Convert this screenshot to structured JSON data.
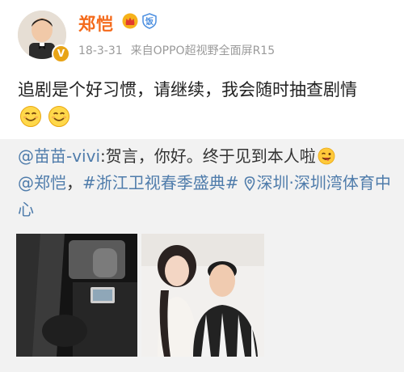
{
  "user": {
    "name": "郑恺",
    "time": "18-3-31",
    "source": "来自OPPO超视野全面屏R15",
    "avatar_icon": "avatar-photo",
    "badge_icon": "verified-v-icon",
    "crown_icon": "crown-icon",
    "fan_icon": "fan-club-icon",
    "name_color": "#f46a1b"
  },
  "post": {
    "text": "追剧是个好习惯，请继续，我会随时抽查剧情",
    "emoji_icon": "smile-emoji-icon"
  },
  "repost": {
    "author": "@苗苗-vivi",
    "text": ":贺言，你好。终于见到本人啦",
    "emoji_icon": "wink-emoji-icon",
    "mention": "@郑恺",
    "separator": "，",
    "topic": "#浙江卫视春季盛典#",
    "location_icon": "location-pin-icon",
    "location": "深圳·深圳湾体育中心",
    "link_color": "#4f7cab",
    "images": [
      {
        "name": "car-photo"
      },
      {
        "name": "selfie-photo"
      }
    ]
  }
}
